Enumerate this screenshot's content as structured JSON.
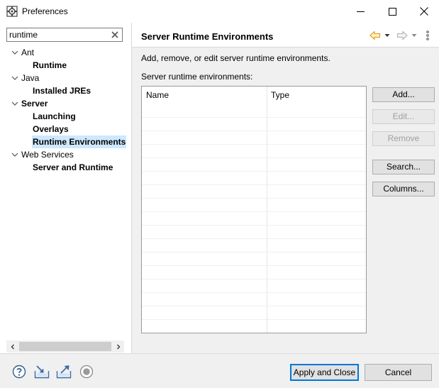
{
  "window": {
    "title": "Preferences",
    "icons": [
      "preferences-app-icon",
      "minimize-icon",
      "maximize-icon",
      "close-icon"
    ]
  },
  "filter": {
    "value": "runtime"
  },
  "tree": {
    "ant": "Ant",
    "ant_runtime": "Runtime",
    "java": "Java",
    "java_installed_jres": "Installed JREs",
    "server": "Server",
    "server_launching": "Launching",
    "server_overlays": "Overlays",
    "server_runtime_environments": "Runtime Environments",
    "web_services": "Web Services",
    "web_services_server_runtime": "Server and Runtime"
  },
  "page": {
    "title": "Server Runtime Environments",
    "description": "Add, remove, or edit server runtime environments.",
    "list_label": "Server runtime environments:",
    "columns": [
      "Name",
      "Type"
    ],
    "rows": []
  },
  "buttons": {
    "add": "Add...",
    "edit": "Edit...",
    "remove": "Remove",
    "search": "Search...",
    "columns": "Columns..."
  },
  "footer": {
    "apply_and_close": "Apply and Close",
    "cancel": "Cancel",
    "icons": [
      "help-icon",
      "import-icon",
      "export-icon",
      "record-icon"
    ]
  },
  "colors": {
    "selection": "#cde8ff",
    "accent": "#0078d7",
    "nav_arrow": "#e8a12a"
  }
}
